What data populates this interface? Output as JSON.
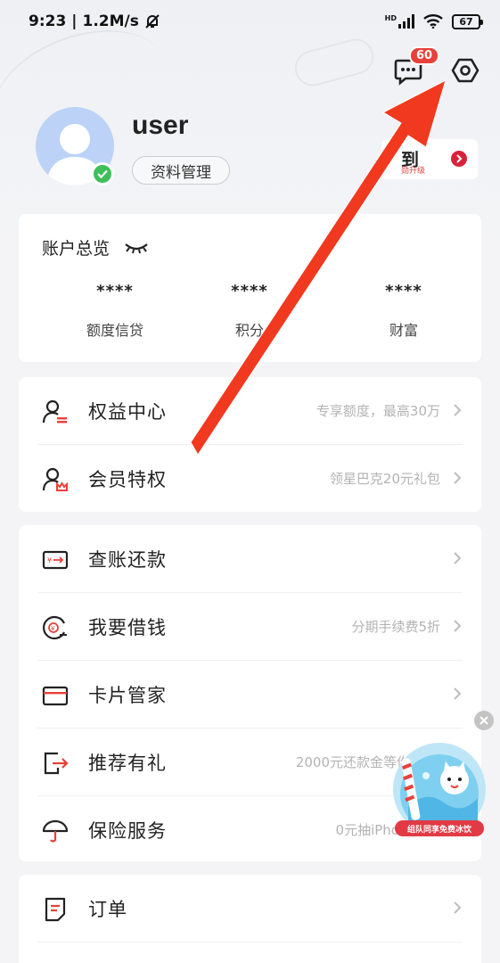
{
  "status_bar": {
    "time": "9:23",
    "speed": "1.2M/s",
    "network_label": "HD",
    "battery": "67"
  },
  "header": {
    "messages_badge": "60",
    "username": "user",
    "profile_button": "资料管理",
    "checkin_title": "到",
    "checkin_sub": "勋升级"
  },
  "overview": {
    "title": "账户总览",
    "items": [
      {
        "value": "****",
        "label": "额度信贷"
      },
      {
        "value": "****",
        "label": "积分"
      },
      {
        "value": "****",
        "label": "财富"
      }
    ]
  },
  "rights": [
    {
      "label": "权益中心",
      "desc": "专享额度，最高30万"
    },
    {
      "label": "会员特权",
      "desc": "领星巴克20元礼包"
    }
  ],
  "services": [
    {
      "label": "查账还款",
      "desc": ""
    },
    {
      "label": "我要借钱",
      "desc": "分期手续费5折"
    },
    {
      "label": "卡片管家",
      "desc": ""
    },
    {
      "label": "推荐有礼",
      "desc": "2000元还款金等你"
    },
    {
      "label": "保险服务",
      "desc": "0元抽iPho"
    }
  ],
  "orders": {
    "label": "订单"
  },
  "promo": {
    "label": "组队同享免费冰饮"
  },
  "colors": {
    "accent": "#e8413a",
    "arrow": "#f0391f"
  }
}
